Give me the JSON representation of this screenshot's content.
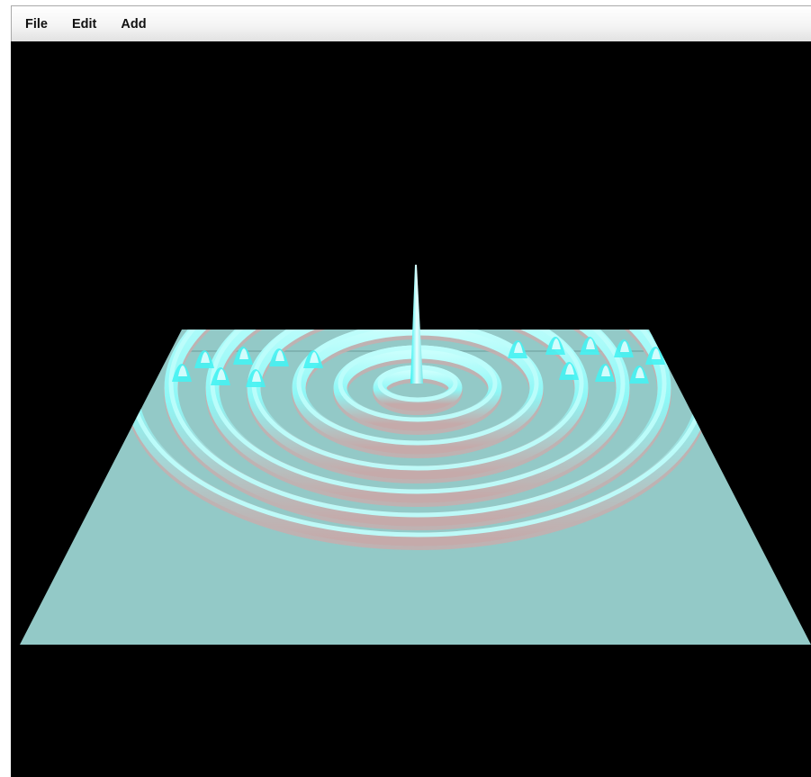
{
  "menu": {
    "items": [
      {
        "label": "File"
      },
      {
        "label": "Edit"
      },
      {
        "label": "Add"
      }
    ]
  },
  "scene": {
    "background_color": "#000000",
    "plane_color": "#93c9c7",
    "ridge_highlight_color": "#bdfdfb",
    "ridge_bright_color": "#46f2f2",
    "ridge_shadow_color": "#c7aeae",
    "surface": "concentric-ripple-wave",
    "ripple_rings": 7
  }
}
